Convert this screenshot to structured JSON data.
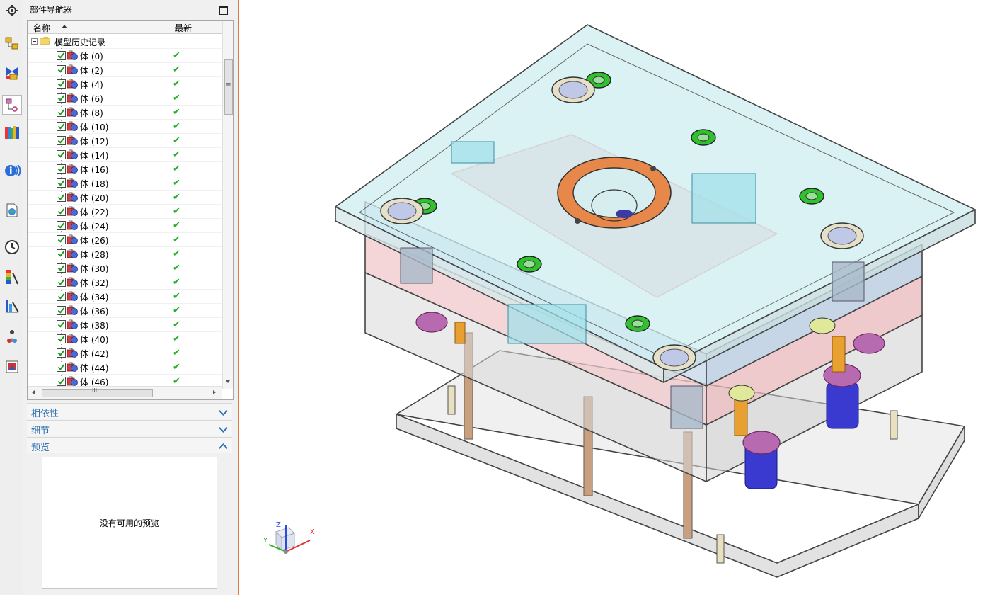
{
  "resource_bar": {
    "icons": [
      "settings-icon",
      "assembly-navigator-icon",
      "constraint-navigator-icon",
      "part-navigator-icon",
      "reuse-library-icon",
      "hd3d-tools-icon",
      "web-browser-icon",
      "history-icon",
      "visualization-icon",
      "process-studio-icon",
      "roles-icon",
      "system-materials-icon"
    ]
  },
  "navigator": {
    "title": "部件导航器",
    "columns": {
      "name": "名称",
      "latest": "最新"
    },
    "root_label": "模型历史记录",
    "items": [
      {
        "label": "体 (0)"
      },
      {
        "label": "体 (2)"
      },
      {
        "label": "体 (4)"
      },
      {
        "label": "体 (6)"
      },
      {
        "label": "体 (8)"
      },
      {
        "label": "体 (10)"
      },
      {
        "label": "体 (12)"
      },
      {
        "label": "体 (14)"
      },
      {
        "label": "体 (16)"
      },
      {
        "label": "体 (18)"
      },
      {
        "label": "体 (20)"
      },
      {
        "label": "体 (22)"
      },
      {
        "label": "体 (24)"
      },
      {
        "label": "体 (26)"
      },
      {
        "label": "体 (28)"
      },
      {
        "label": "体 (30)"
      },
      {
        "label": "体 (32)"
      },
      {
        "label": "体 (34)"
      },
      {
        "label": "体 (36)"
      },
      {
        "label": "体 (38)"
      },
      {
        "label": "体 (40)"
      },
      {
        "label": "体 (42)"
      },
      {
        "label": "体 (44)"
      },
      {
        "label": "体 (46)"
      }
    ],
    "scroll_grip": "≡",
    "hscroll_grip": "III"
  },
  "sections": {
    "dependencies": "相依性",
    "details": "细节",
    "preview": "预览"
  },
  "preview": {
    "message": "没有可用的预览"
  },
  "triad": {
    "x": "X",
    "y": "Y",
    "z": "Z"
  },
  "colors": {
    "accent_border": "#e07a3a",
    "section_text": "#2a6fb0",
    "check_green": "#22b022"
  }
}
